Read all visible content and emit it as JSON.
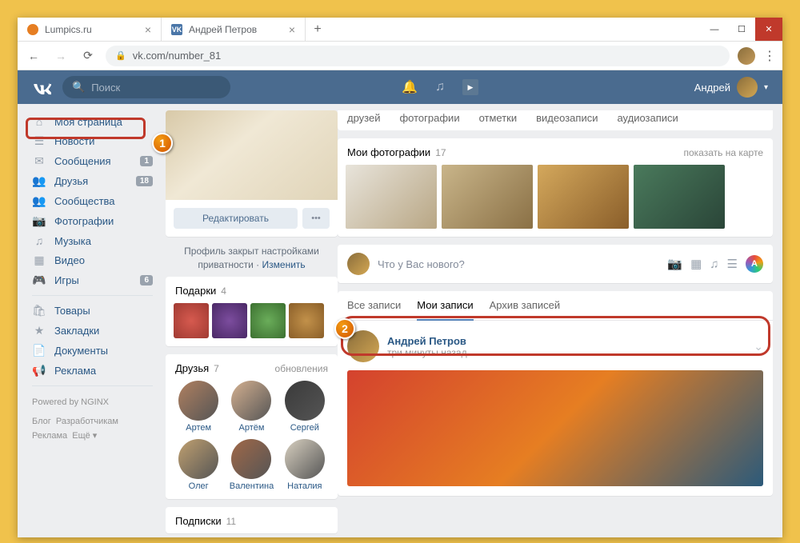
{
  "browser": {
    "tabs": [
      {
        "title": "Lumpics.ru",
        "favicon_bg": "#e67e22"
      },
      {
        "title": "Андрей Петров",
        "favicon_bg": "#4a76a8"
      }
    ],
    "url": "vk.com/number_81"
  },
  "vk": {
    "search_placeholder": "Поиск",
    "user_name": "Андрей",
    "sidebar": [
      {
        "icon": "⌂",
        "label": "Моя страница",
        "badge": null,
        "active": true
      },
      {
        "icon": "☰",
        "label": "Новости",
        "badge": null
      },
      {
        "icon": "✉",
        "label": "Сообщения",
        "badge": "1"
      },
      {
        "icon": "👥",
        "label": "Друзья",
        "badge": "18"
      },
      {
        "icon": "👥",
        "label": "Сообщества",
        "badge": null
      },
      {
        "icon": "📷",
        "label": "Фотографии",
        "badge": null
      },
      {
        "icon": "♫",
        "label": "Музыка",
        "badge": null
      },
      {
        "icon": "▦",
        "label": "Видео",
        "badge": null
      },
      {
        "icon": "🎮",
        "label": "Игры",
        "badge": "6"
      }
    ],
    "sidebar2": [
      {
        "icon": "🛍",
        "label": "Товары"
      },
      {
        "icon": "★",
        "label": "Закладки"
      },
      {
        "icon": "📄",
        "label": "Документы"
      },
      {
        "icon": "📢",
        "label": "Реклама"
      }
    ],
    "powered": "Powered by NGINX",
    "footer_links": [
      "Блог",
      "Разработчикам",
      "Реклама",
      "Ещё ▾"
    ],
    "profile": {
      "edit": "Редактировать",
      "privacy_text": "Профиль закрыт настройками приватности · ",
      "privacy_link": "Изменить"
    },
    "gifts_block": {
      "title": "Подарки",
      "count": "4"
    },
    "friends_block": {
      "title": "Друзья",
      "count": "7",
      "right": "обновления",
      "names": [
        "Артем",
        "Артём",
        "Сергей",
        "Олег",
        "Валентина",
        "Наталия"
      ]
    },
    "subs_block": {
      "title": "Подписки",
      "count": "11"
    },
    "top_tabs": [
      "друзей",
      "фотографии",
      "отметки",
      "видеозаписи",
      "аудиозаписи"
    ],
    "photos_block": {
      "title": "Мои фотографии",
      "count": "17",
      "right": "показать на карте"
    },
    "post_placeholder": "Что у Вас нового?",
    "wall_tabs": [
      "Все записи",
      "Мои записи",
      "Архив записей"
    ],
    "wall_active_idx": 1,
    "post": {
      "author": "Андрей Петров",
      "time": "три минуты назад"
    }
  },
  "markers": {
    "m1": "1",
    "m2": "2"
  }
}
